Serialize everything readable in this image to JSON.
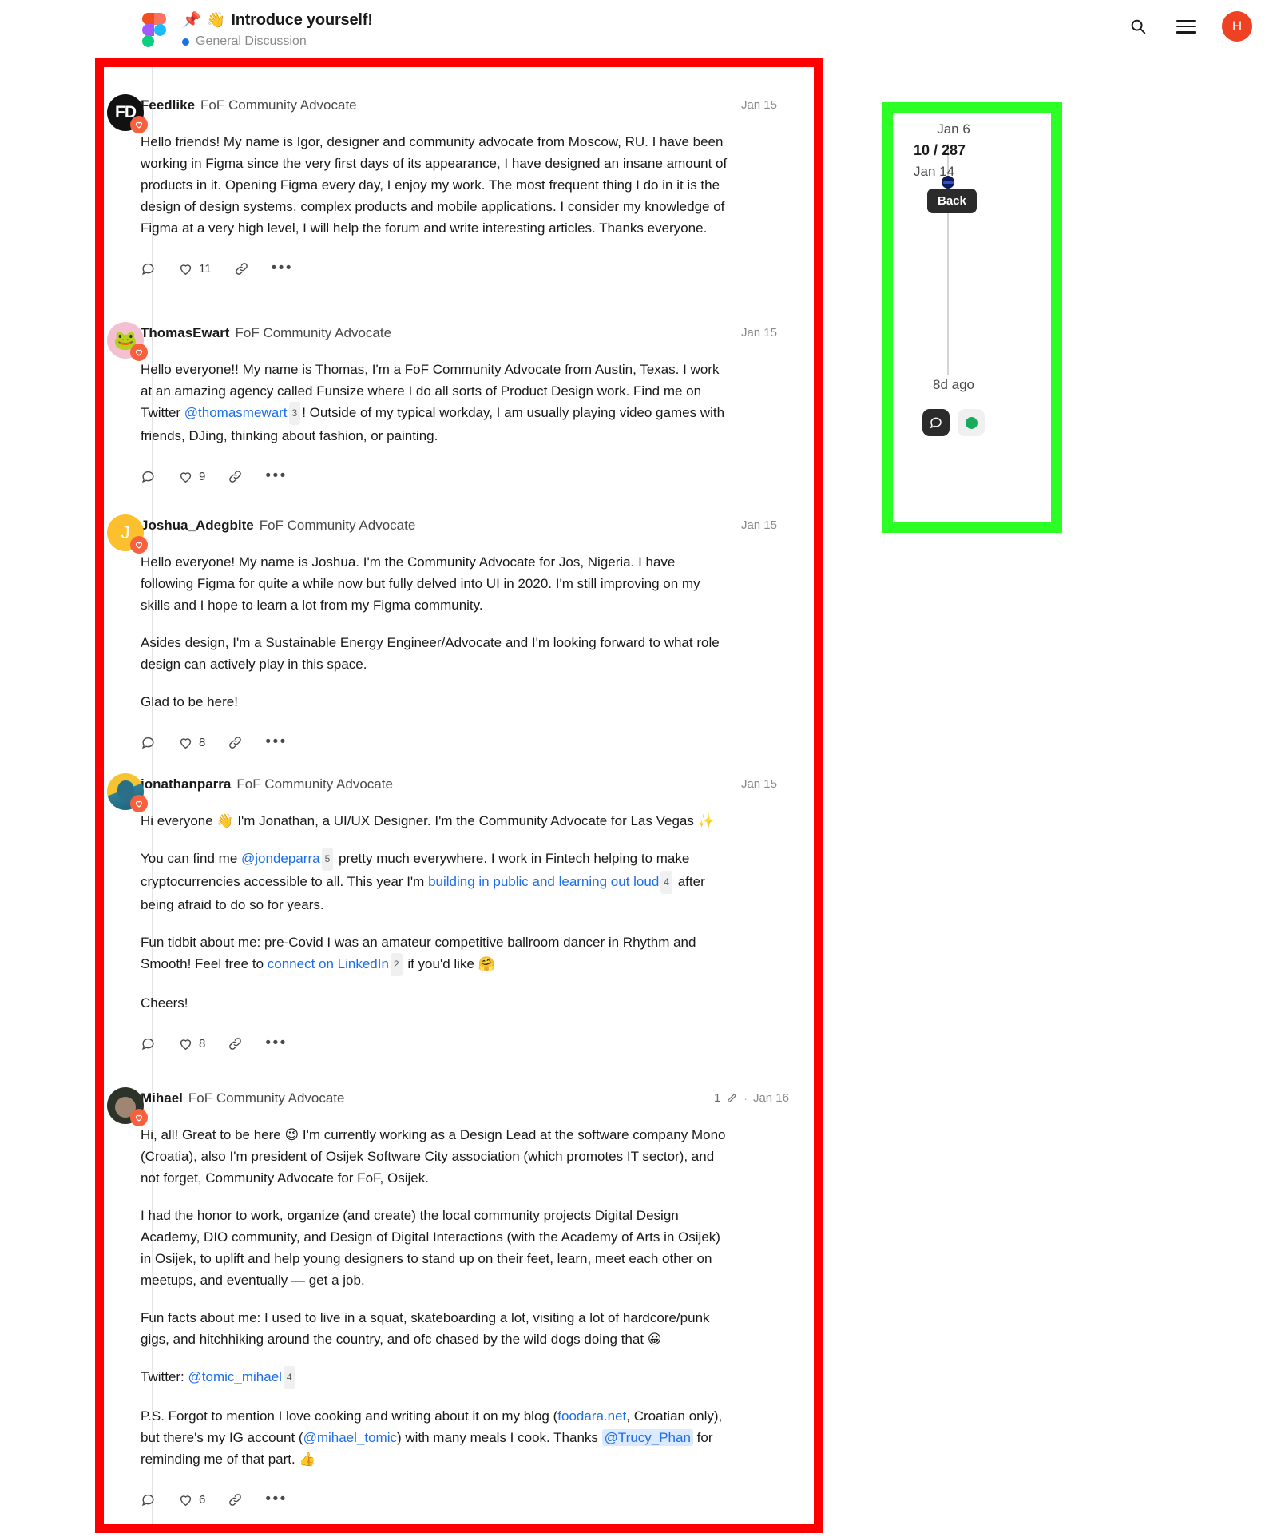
{
  "header": {
    "logo": "figma-logo",
    "pin_icon": "pin-icon",
    "wave_emoji": "👋",
    "title": "Introduce yourself!",
    "category": "General Discussion",
    "search_icon": "search-icon",
    "menu_icon": "hamburger-menu-icon",
    "avatar_initial": "H",
    "avatar_color": "#ef4123"
  },
  "timeline": {
    "start_date": "Jan 6",
    "counter": "10 / 287",
    "current_date": "Jan 14",
    "back_label": "Back",
    "last_activity": "8d ago",
    "chat_icon": "chat-bubble-icon",
    "status_icon": "online-status-dot",
    "status_color": "#1aab5a",
    "handle_color": "#0b1a5c"
  },
  "posts": [
    {
      "author": "Feedlike",
      "badge": "FoF Community Advocate",
      "date": "Jan 15",
      "avatar_text": "FD",
      "avatar_kind": "av-feedlike",
      "paragraphs": [
        "Hello friends! My name is Igor, designer and community advocate from Moscow, RU. I have been working in Figma since the very first days of its appearance, I have designed an insane amount of products in it. Opening Figma every day, I enjoy my work. The most frequent thing I do in it is the design of design systems, complex products and mobile applications. I consider my knowledge of Figma at a very high level, I will help the forum and write interesting articles. Thanks everyone."
      ],
      "likes": "11",
      "reply_icon": "reply-icon",
      "like_icon": "heart-icon",
      "link_icon": "link-icon",
      "more_icon": "more-options-icon"
    },
    {
      "author": "ThomasEwart",
      "badge": "FoF Community Advocate",
      "date": "Jan 15",
      "avatar_text": "🐸",
      "avatar_kind": "av-thomas",
      "likes": "9"
    },
    {
      "author": "Joshua_Adegbite",
      "badge": "FoF Community Advocate",
      "date": "Jan 15",
      "avatar_text": "J",
      "avatar_kind": "av-joshua",
      "paragraphs": [
        "Hello everyone! My name is Joshua. I'm the Community Advocate for Jos, Nigeria. I have following Figma for quite a while now but fully delved into UI in 2020. I'm still improving on my skills and I hope to learn a lot from my Figma community.",
        "Asides design, I'm a Sustainable Energy Engineer/Advocate and I'm looking forward to what role design can actively play in this space.",
        "Glad to be here!"
      ],
      "likes": "8"
    },
    {
      "author": "jonathanparra",
      "badge": "FoF Community Advocate",
      "date": "Jan 15",
      "avatar_text": "",
      "avatar_kind": "av-jon",
      "likes": "8"
    },
    {
      "author": "Mihael",
      "badge": "FoF Community Advocate",
      "date": "Jan 16",
      "edit_count": "1",
      "edit_icon": "pencil-icon",
      "avatar_text": "",
      "avatar_kind": "av-mihael",
      "likes": "6"
    }
  ],
  "post2_text": {
    "a": "Hello everyone!! My name is Thomas, I'm a FoF Community Advocate from Austin, Texas. I work at an amazing agency called Funsize where I do all sorts of Product Design work. Find me on Twitter ",
    "mention": "@thomasmewart",
    "ref": "3",
    "b": "! Outside of my typical workday, I am usually playing video games with friends, DJing, thinking about fashion, or painting."
  },
  "post4_text": {
    "p1a": "Hi everyone 👋 I'm Jonathan, a UI/UX Designer. I'm the Community Advocate for Las Vegas ✨",
    "p2a": "You can find me ",
    "p2_mention": "@jondeparra",
    "p2_ref1": "5",
    "p2b": " pretty much everywhere. I work in Fintech helping to make cryptocurrencies accessible to all. This year I'm ",
    "p2_link": "building in public and learning out loud",
    "p2_ref2": "4",
    "p2c": " after being afraid to do so for years.",
    "p3a": "Fun tidbit about me: pre-Covid I was an amateur competitive ballroom dancer in Rhythm and Smooth! Feel free to ",
    "p3_link": "connect on LinkedIn",
    "p3_ref": "2",
    "p3b": " if you'd like 🤗",
    "p4": "Cheers!"
  },
  "post5_text": {
    "p1": "Hi, all! Great to be here 😉 I'm currently working as a Design Lead at the software company Mono (Croatia), also I'm president of Osijek Software City association (which promotes IT sector), and not forget, Community Advocate for FoF, Osijek.",
    "p2": "I had the honor to work, organize (and create) the local community projects Digital Design Academy, DIO community, and Design of Digital Interactions (with the Academy of Arts in Osijek) in Osijek, to uplift and help young designers to stand up on their feet, learn, meet each other on meetups, and eventually — get a job.",
    "p3": "Fun facts about me: I used to live in a squat, skateboarding a lot, visiting a lot of hardcore/punk gigs, and hitchhiking around the country, and ofc chased by the wild dogs doing that 😀",
    "p4a": "Twitter: ",
    "p4_mention": "@tomic_mihael",
    "p4_ref": "4",
    "p5a": "P.S. Forgot to mention I love cooking and writing about it on my blog (",
    "p5_link1": "foodara.net",
    "p5b": ", Croatian only), but there's my IG account (",
    "p5_link2": "@mihael_tomic",
    "p5c": ") with many meals I cook. Thanks ",
    "p5_mention": "@Trucy_Phan",
    "p5d": " for reminding me of that part. 👍"
  },
  "annotations": {
    "red_box_color": "#ff0000",
    "green_box_color": "#2bff26"
  }
}
